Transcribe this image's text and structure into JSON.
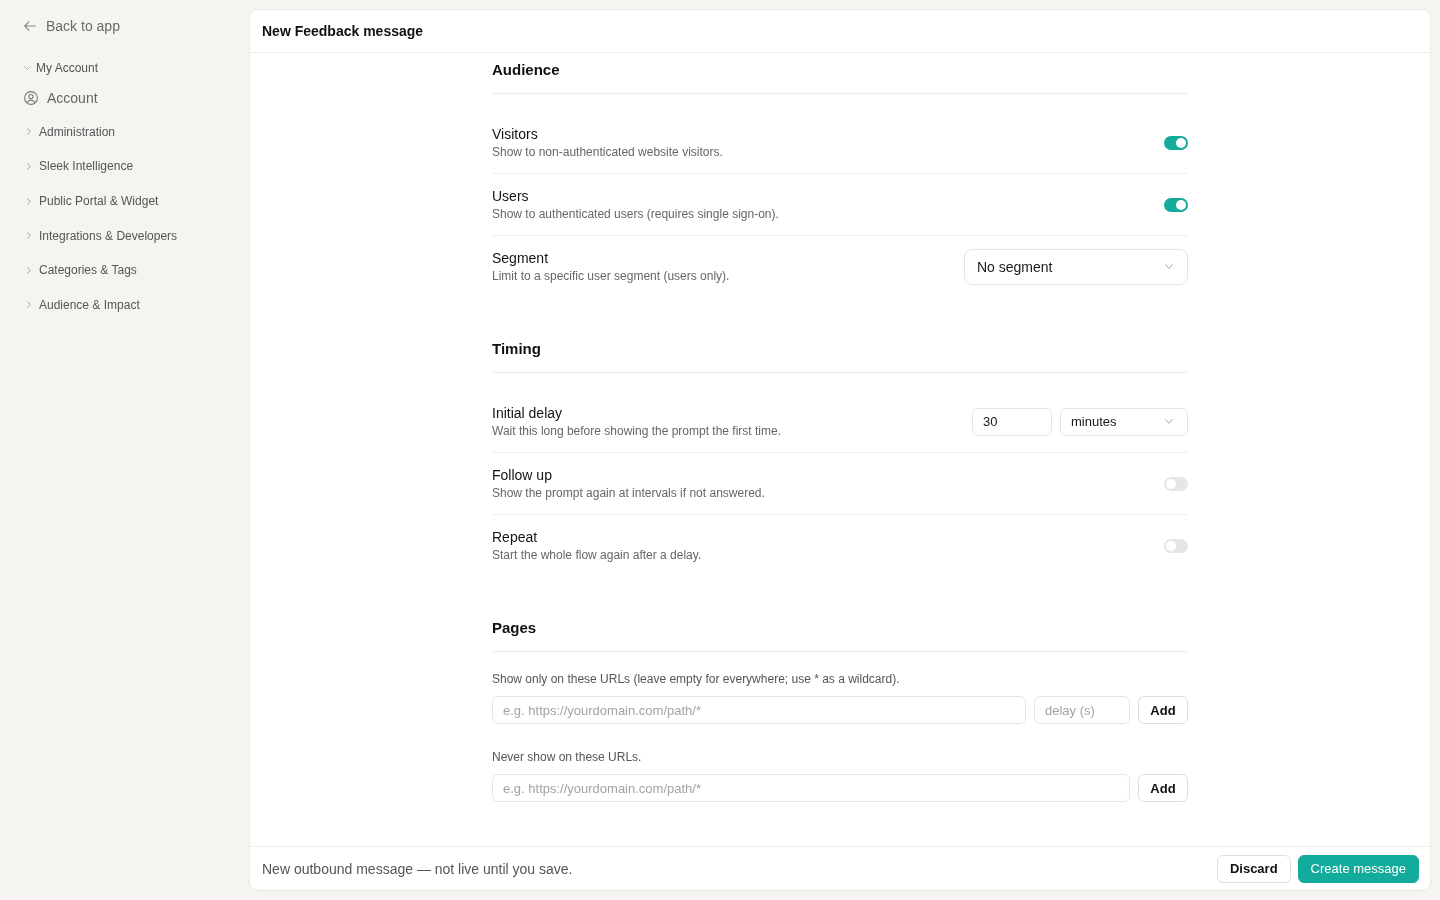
{
  "sidebar": {
    "back_link": "Back to app",
    "groups": [
      {
        "label": "My Account",
        "expanded": true,
        "children": [
          {
            "label": "Account"
          }
        ]
      },
      {
        "label": "Administration",
        "expanded": false
      },
      {
        "label": "Sleek Intelligence",
        "expanded": false
      },
      {
        "label": "Public Portal & Widget",
        "expanded": false
      },
      {
        "label": "Integrations & Developers",
        "expanded": false
      },
      {
        "label": "Categories & Tags",
        "expanded": false
      },
      {
        "label": "Audience & Impact",
        "expanded": false
      }
    ]
  },
  "panel": {
    "title": "New Feedback message"
  },
  "sections": [
    {
      "title": "Audience",
      "rows": [
        {
          "kind": "toggle",
          "label": "Visitors",
          "description": "Show to non-authenticated website visitors.",
          "on": true
        },
        {
          "kind": "toggle",
          "label": "Users",
          "description": "Show to authenticated users (requires single sign-on).",
          "on": true
        },
        {
          "kind": "select",
          "label": "Segment",
          "description": "Limit to a specific user segment (users only).",
          "value": "No segment"
        }
      ]
    },
    {
      "title": "Timing",
      "rows": [
        {
          "kind": "delay",
          "label": "Initial delay",
          "description": "Wait this long before showing the prompt the first time.",
          "amount": "30",
          "unit": "minutes"
        },
        {
          "kind": "toggle",
          "label": "Follow up",
          "description": "Show the prompt again at intervals if not answered.",
          "on": false
        },
        {
          "kind": "toggle",
          "label": "Repeat",
          "description": "Start the whole flow again after a delay.",
          "on": false
        }
      ]
    }
  ],
  "pages": {
    "title": "Pages",
    "url_lists": [
      {
        "hint": "Show only on these URLs (leave empty for everywhere; use * as a wildcard).",
        "url_placeholder": "e.g. https://yourdomain.com/path/*",
        "delay_placeholder": "delay (s)",
        "button": "Add"
      },
      {
        "hint": "Never show on these URLs.",
        "url_placeholder": "e.g. https://yourdomain.com/path/*",
        "button": "Add"
      }
    ]
  },
  "footer": {
    "note": "New outbound message — not live until you save.",
    "buttons": [
      {
        "label": "Discard",
        "kind": "secondary"
      },
      {
        "label": "Create message",
        "kind": "primary"
      }
    ]
  }
}
